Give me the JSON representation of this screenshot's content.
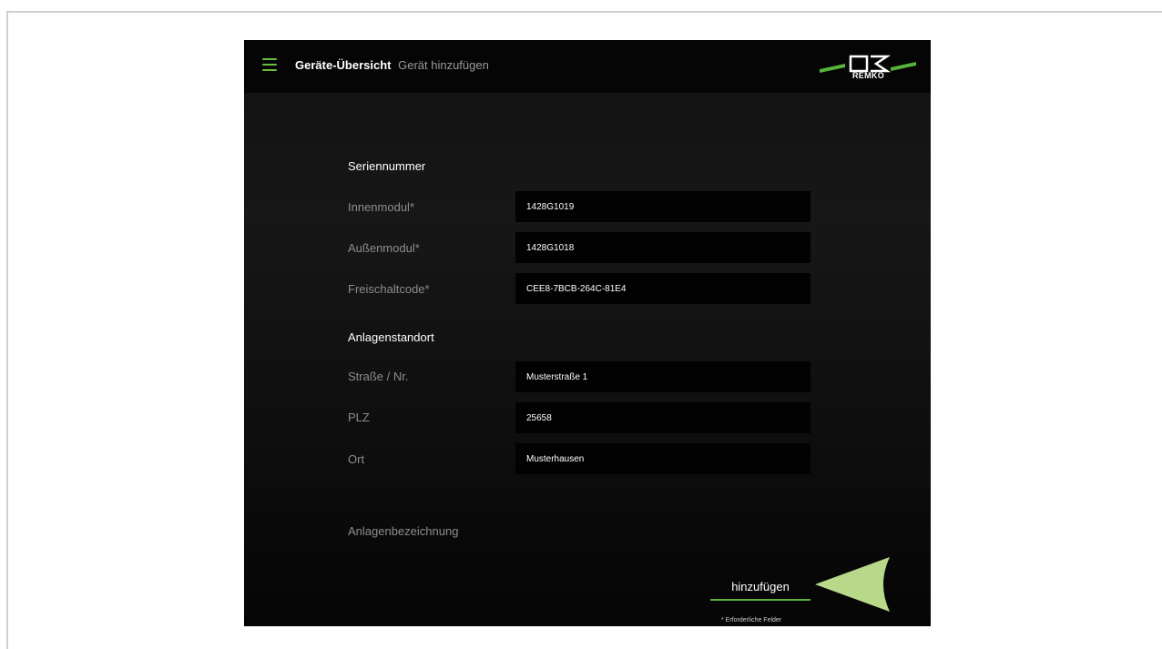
{
  "header": {
    "breadcrumb_main": "Geräte-Übersicht",
    "breadcrumb_sub": "Gerät hinzufügen",
    "logo_text": "REMKO"
  },
  "form": {
    "serial_section": "Seriennummer",
    "indoor_label": "Innenmodul*",
    "indoor_value": "1428G1019",
    "outdoor_label": "Außenmodul*",
    "outdoor_value": "1428G1018",
    "unlock_label": "Freischaltcode*",
    "unlock_value": "CEE8-7BCB-264C-81E4",
    "location_section": "Anlagenstandort",
    "street_label": "Straße / Nr.",
    "street_value": "Musterstraße 1",
    "zip_label": "PLZ",
    "zip_value": "25658",
    "city_label": "Ort",
    "city_value": "Musterhausen",
    "system_name_label": "Anlagenbezeichnung"
  },
  "actions": {
    "add_label": "hinzufügen",
    "required_note": "* Erforderliche Felder"
  },
  "icons": {
    "menu": "hamburger-menu-icon",
    "pointer": "arrow-pointer-icon"
  },
  "colors": {
    "accent": "#58b33a",
    "background": "#111111",
    "pointer": "#b8d98a"
  }
}
